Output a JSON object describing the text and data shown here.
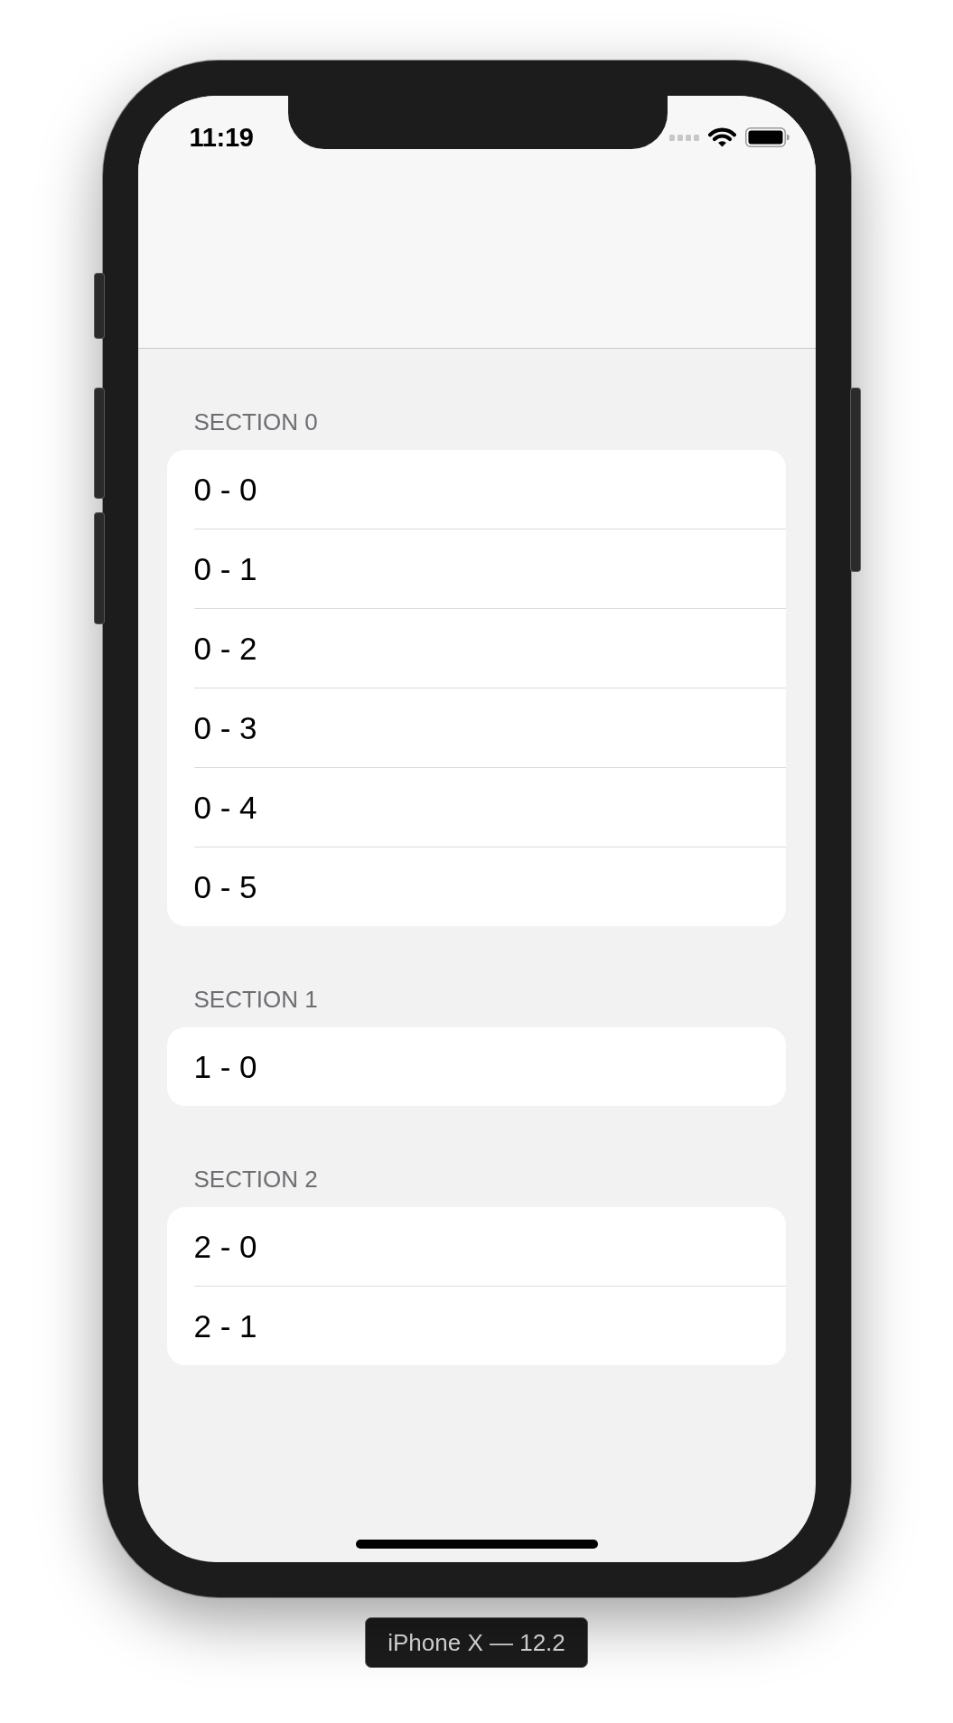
{
  "status_bar": {
    "time": "11:19"
  },
  "sections": [
    {
      "header": "SECTION 0",
      "rows": [
        "0 - 0",
        "0 - 1",
        "0 - 2",
        "0 - 3",
        "0 - 4",
        "0 - 5"
      ]
    },
    {
      "header": "SECTION 1",
      "rows": [
        "1 - 0"
      ]
    },
    {
      "header": "SECTION 2",
      "rows": [
        "2 - 0",
        "2 - 1"
      ]
    }
  ],
  "device_label": "iPhone X — 12.2"
}
